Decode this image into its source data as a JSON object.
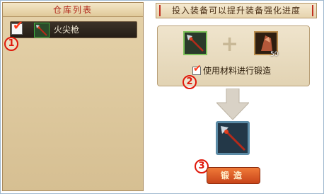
{
  "warehouse": {
    "title": "仓库列表",
    "items": [
      {
        "name": "火尖枪",
        "checked": true
      }
    ]
  },
  "forge": {
    "hint": "投入装备可以提升装备强化进度",
    "material_count": "50",
    "use_material_label": "使用材料进行锻造",
    "use_material_checked": true,
    "forge_button_label": "锻造"
  },
  "callouts": [
    "1",
    "2",
    "3"
  ],
  "colors": {
    "accent": "#e0180a",
    "panel": "#e5d2aa",
    "button": "#d8581f"
  }
}
